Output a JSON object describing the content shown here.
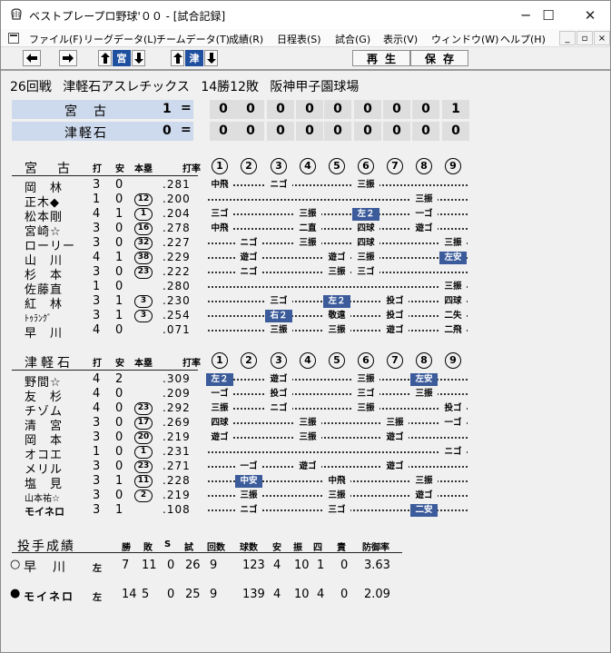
{
  "window": {
    "title": "ベストプレープロ野球'００ - [試合記録]",
    "minimize": "─",
    "maximize": "☐",
    "close": "✕"
  },
  "menu": [
    "ファイル(F)",
    "リーグデータ(L)",
    "チームデータ(T)",
    "成績(R)",
    "日程表(S)",
    "試合(G)",
    "表示(V)",
    "ウィンドウ(W)",
    "ヘルプ(H)"
  ],
  "mdi_buttons": [
    "_",
    "▫",
    "×"
  ],
  "toolbar": {
    "prev_icon": "arrow-left",
    "next_icon": "arrow-right",
    "team1": "宮",
    "team2": "津",
    "play_label": "再生",
    "save_label": "保存"
  },
  "game": {
    "round": "26回戦",
    "team": "津軽石アスレチックス",
    "record": "14勝12敗",
    "stadium": "阪神甲子園球場"
  },
  "scoreboard": [
    {
      "team": "宮　古",
      "total": "1",
      "eq": "=",
      "innings": [
        "0",
        "0",
        "0",
        "0",
        "0",
        "0",
        "0",
        "0",
        "1"
      ]
    },
    {
      "team": "津軽石",
      "total": "0",
      "eq": "=",
      "innings": [
        "0",
        "0",
        "0",
        "0",
        "0",
        "0",
        "0",
        "0",
        "0"
      ]
    }
  ],
  "column_headers": {
    "ab": "打",
    "h": "安",
    "hr": "本塁",
    "avg": "打率"
  },
  "inning_labels": [
    "①",
    "②",
    "③",
    "④",
    "⑤",
    "⑥",
    "⑦",
    "⑧",
    "⑨"
  ],
  "teams": [
    {
      "name": "宮　古",
      "batters": [
        {
          "name": "岡　林",
          "ab": "3",
          "h": "0",
          "hr": "",
          "avg": ".281",
          "results": [
            {
              "i": 1,
              "t": "中飛"
            },
            {
              "i": 3,
              "t": "ニゴ"
            },
            {
              "i": 6,
              "t": "三振"
            }
          ]
        },
        {
          "name": "正木◆",
          "ab": "1",
          "h": "0",
          "hr": "12",
          "avg": ".200",
          "results": [
            {
              "i": 8,
              "t": "三振"
            }
          ]
        },
        {
          "name": "松本剛",
          "ab": "4",
          "h": "1",
          "hr": "1",
          "avg": ".204",
          "results": [
            {
              "i": 1,
              "t": "三ゴ"
            },
            {
              "i": 4,
              "t": "三振"
            },
            {
              "i": 6,
              "t": "左２",
              "hit": true
            },
            {
              "i": 8,
              "t": "一ゴ"
            }
          ]
        },
        {
          "name": "宮崎☆",
          "ab": "3",
          "h": "0",
          "hr": "16",
          "avg": ".278",
          "results": [
            {
              "i": 1,
              "t": "中飛"
            },
            {
              "i": 4,
              "t": "二直"
            },
            {
              "i": 6,
              "t": "四球"
            },
            {
              "i": 8,
              "t": "遊ゴ"
            }
          ]
        },
        {
          "name": "ローリー",
          "ab": "3",
          "h": "0",
          "hr": "32",
          "avg": ".227",
          "results": [
            {
              "i": 2,
              "t": "ニゴ"
            },
            {
              "i": 4,
              "t": "三振"
            },
            {
              "i": 6,
              "t": "四球"
            },
            {
              "i": 9,
              "t": "三振"
            }
          ]
        },
        {
          "name": "山　川",
          "ab": "4",
          "h": "1",
          "hr": "38",
          "avg": ".229",
          "results": [
            {
              "i": 2,
              "t": "遊ゴ"
            },
            {
              "i": 5,
              "t": "遊ゴ"
            },
            {
              "i": 6,
              "t": "三振"
            },
            {
              "i": 9,
              "t": "左安",
              "hit": true
            }
          ]
        },
        {
          "name": "杉　本",
          "ab": "3",
          "h": "0",
          "hr": "23",
          "avg": ".222",
          "results": [
            {
              "i": 2,
              "t": "ニゴ"
            },
            {
              "i": 5,
              "t": "三振"
            },
            {
              "i": 6,
              "t": "三ゴ"
            }
          ]
        },
        {
          "name": "佐藤直",
          "ab": "1",
          "h": "0",
          "hr": "",
          "avg": ".280",
          "results": [
            {
              "i": 9,
              "t": "三振"
            }
          ]
        },
        {
          "name": "紅　林",
          "ab": "3",
          "h": "1",
          "hr": "3",
          "avg": ".230",
          "results": [
            {
              "i": 3,
              "t": "三ゴ"
            },
            {
              "i": 5,
              "t": "左２",
              "hit": true
            },
            {
              "i": 7,
              "t": "投ゴ"
            },
            {
              "i": 9,
              "t": "四球"
            }
          ]
        },
        {
          "name": "ﾄｩﾗﾝｸﾞ",
          "small": true,
          "ab": "3",
          "h": "1",
          "hr": "3",
          "avg": ".254",
          "results": [
            {
              "i": 3,
              "t": "右２",
              "hit": true
            },
            {
              "i": 5,
              "t": "敬遠"
            },
            {
              "i": 7,
              "t": "投ゴ"
            },
            {
              "i": 9,
              "t": "二失"
            }
          ]
        },
        {
          "name": "早　川",
          "ab": "4",
          "h": "0",
          "hr": "",
          "avg": ".071",
          "results": [
            {
              "i": 3,
              "t": "三振"
            },
            {
              "i": 5,
              "t": "三振"
            },
            {
              "i": 7,
              "t": "遊ゴ"
            },
            {
              "i": 9,
              "t": "二飛"
            }
          ]
        }
      ]
    },
    {
      "name": "津軽石",
      "batters": [
        {
          "name": "野間☆",
          "ab": "4",
          "h": "2",
          "hr": "",
          "avg": ".309",
          "results": [
            {
              "i": 1,
              "t": "左２",
              "hit": true
            },
            {
              "i": 3,
              "t": "遊ゴ"
            },
            {
              "i": 6,
              "t": "三振"
            },
            {
              "i": 8,
              "t": "左安",
              "hit": true
            }
          ]
        },
        {
          "name": "友　杉",
          "ab": "4",
          "h": "0",
          "hr": "",
          "avg": ".209",
          "results": [
            {
              "i": 1,
              "t": "一ゴ"
            },
            {
              "i": 3,
              "t": "投ゴ"
            },
            {
              "i": 6,
              "t": "三ゴ"
            },
            {
              "i": 8,
              "t": "三振"
            }
          ]
        },
        {
          "name": "チゾム",
          "ab": "4",
          "h": "0",
          "hr": "23",
          "avg": ".292",
          "results": [
            {
              "i": 1,
              "t": "三振"
            },
            {
              "i": 3,
              "t": "ニゴ"
            },
            {
              "i": 6,
              "t": "三振"
            },
            {
              "i": 9,
              "t": "投ゴ"
            }
          ]
        },
        {
          "name": "清　宮",
          "ab": "3",
          "h": "0",
          "hr": "17",
          "avg": ".269",
          "results": [
            {
              "i": 1,
              "t": "四球"
            },
            {
              "i": 4,
              "t": "三振"
            },
            {
              "i": 7,
              "t": "三振"
            },
            {
              "i": 9,
              "t": "一ゴ"
            }
          ]
        },
        {
          "name": "岡　本",
          "ab": "3",
          "h": "0",
          "hr": "20",
          "avg": ".219",
          "results": [
            {
              "i": 1,
              "t": "遊ゴ"
            },
            {
              "i": 4,
              "t": "三振"
            },
            {
              "i": 7,
              "t": "遊ゴ"
            }
          ]
        },
        {
          "name": "オコエ",
          "ab": "1",
          "h": "0",
          "hr": "1",
          "avg": ".231",
          "results": [
            {
              "i": 9,
              "t": "ニゴ"
            }
          ]
        },
        {
          "name": "メリル",
          "ab": "3",
          "h": "0",
          "hr": "23",
          "avg": ".271",
          "results": [
            {
              "i": 2,
              "t": "一ゴ"
            },
            {
              "i": 4,
              "t": "遊ゴ"
            },
            {
              "i": 7,
              "t": "遊ゴ"
            }
          ]
        },
        {
          "name": "塩　見",
          "ab": "3",
          "h": "1",
          "hr": "11",
          "avg": ".228",
          "results": [
            {
              "i": 2,
              "t": "中安",
              "hit": true
            },
            {
              "i": 5,
              "t": "中飛"
            },
            {
              "i": 8,
              "t": "三振"
            }
          ]
        },
        {
          "name": "山本祐☆",
          "small": true,
          "ab": "3",
          "h": "0",
          "hr": "2",
          "avg": ".219",
          "results": [
            {
              "i": 2,
              "t": "三振"
            },
            {
              "i": 5,
              "t": "三振"
            },
            {
              "i": 8,
              "t": "遊ゴ"
            }
          ]
        },
        {
          "name": "モイネロ",
          "smallbold": true,
          "ab": "3",
          "h": "1",
          "hr": "",
          "avg": ".108",
          "results": [
            {
              "i": 2,
              "t": "ニゴ"
            },
            {
              "i": 5,
              "t": "三ゴ"
            },
            {
              "i": 8,
              "t": "二安",
              "hit": true
            }
          ]
        }
      ]
    }
  ],
  "pitching": {
    "title": "投手成績",
    "headers": [
      "勝",
      "敗",
      "S",
      "試",
      "回数",
      "球数",
      "安",
      "振",
      "四",
      "責",
      "防御率"
    ],
    "pitchers": [
      {
        "mark": "○",
        "name": "早　川",
        "hand": "左",
        "stats": [
          "7",
          "11",
          "0",
          "26",
          "9",
          "123",
          "4",
          "10",
          "1",
          "0",
          "3.63"
        ]
      },
      {
        "mark": "●",
        "name": "モイネロ",
        "hand": "左",
        "stats": [
          "14",
          "5",
          "0",
          "25",
          "9",
          "139",
          "4",
          "10",
          "4",
          "0",
          "2.09"
        ]
      }
    ]
  }
}
